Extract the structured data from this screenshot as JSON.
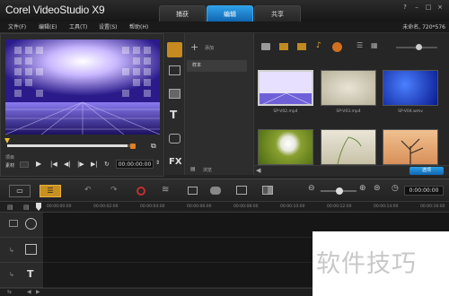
{
  "app": {
    "title": "Corel VideoStudio X9"
  },
  "tabs": [
    {
      "label": "捕获",
      "active": false
    },
    {
      "label": "编辑",
      "active": true
    },
    {
      "label": "共享",
      "active": false
    }
  ],
  "window_controls": [
    "?",
    "–",
    "□",
    "×"
  ],
  "menu": [
    "文件(F)",
    "编辑(E)",
    "工具(T)",
    "设置(S)",
    "帮助(H)"
  ],
  "project_info": "未命名, 720*576",
  "player": {
    "mode_labels": [
      "项目",
      "素材"
    ],
    "timecode": "00:00:00:00",
    "progress": 0.96
  },
  "library": {
    "add_label": "添加",
    "folders": [
      {
        "label": "样本",
        "selected": true
      }
    ],
    "browse_label": "浏览",
    "options_label": "选项",
    "thumbnails": [
      {
        "label": "SP-V02.mp4",
        "selected": true
      },
      {
        "label": "SP-V03.mp4",
        "selected": false
      },
      {
        "label": "SP-V04.wmv",
        "selected": false
      },
      {
        "label": "",
        "selected": false
      },
      {
        "label": "",
        "selected": false
      },
      {
        "label": "",
        "selected": false
      }
    ]
  },
  "nav_icons": [
    "media-icon",
    "instant-project-icon",
    "transition-icon",
    "title-icon",
    "graphic-icon",
    "filter-icon"
  ],
  "nav_text": {
    "title": "T",
    "fx": "FX"
  },
  "timeline": {
    "timecode": "0:00:00:00",
    "ruler_ticks": [
      "00:00:00:00",
      "00:00:02:00",
      "00:00:04:00",
      "00:00:06:00",
      "00:00:08:00",
      "00:00:10:00",
      "00:00:12:00",
      "00:00:14:00",
      "00:00:16:00"
    ],
    "track_icons": [
      "video-track-icon",
      "overlay-track-icon",
      "title-track-icon"
    ],
    "title_track_letter": "T"
  },
  "watermark": {
    "text": "软件技巧"
  },
  "colors": {
    "accent": "#1a7fd0",
    "background": "#232323"
  }
}
